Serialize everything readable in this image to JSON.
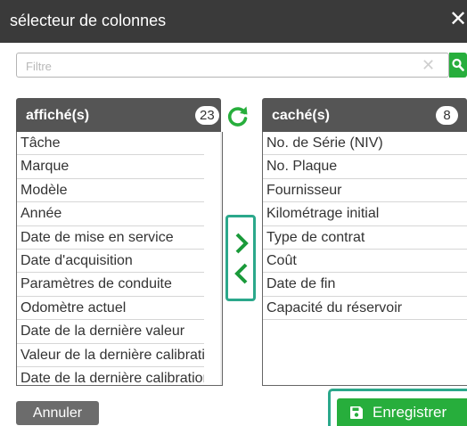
{
  "window": {
    "title": "sélecteur de colonnes",
    "close_glyph": "✕"
  },
  "filter": {
    "placeholder": "Filtre",
    "clear_glyph": "✕",
    "search_icon": "search-icon"
  },
  "shown": {
    "label": "affiché(s)",
    "count": "23",
    "items": [
      "Tâche",
      "Marque",
      "Modèle",
      "Année",
      "Date de mise en service",
      "Date d'acquisition",
      "Paramètres de conduite",
      "Odomètre actuel",
      "Date de la dernière valeur",
      "Valeur de la dernière calibration",
      "Date de la dernière calibration"
    ]
  },
  "hidden": {
    "label": "caché(s)",
    "count": "8",
    "items": [
      "No. de Série (NIV)",
      "No. Plaque",
      "Fournisseur",
      "Kilométrage initial",
      "Type de contrat",
      "Coût",
      "Date de fin",
      "Capacité du réservoir"
    ]
  },
  "icons": {
    "refresh": "refresh-icon",
    "move_right": "chevron-right-icon",
    "move_left": "chevron-left-icon",
    "save": "floppy-disk-icon"
  },
  "colors": {
    "titlebar": "#3a3a3a",
    "header": "#555555",
    "accent_green": "#27ae3c",
    "highlight": "#2ba88b"
  },
  "actions": {
    "cancel_label": "Annuler",
    "save_label": "Enregistrer"
  }
}
